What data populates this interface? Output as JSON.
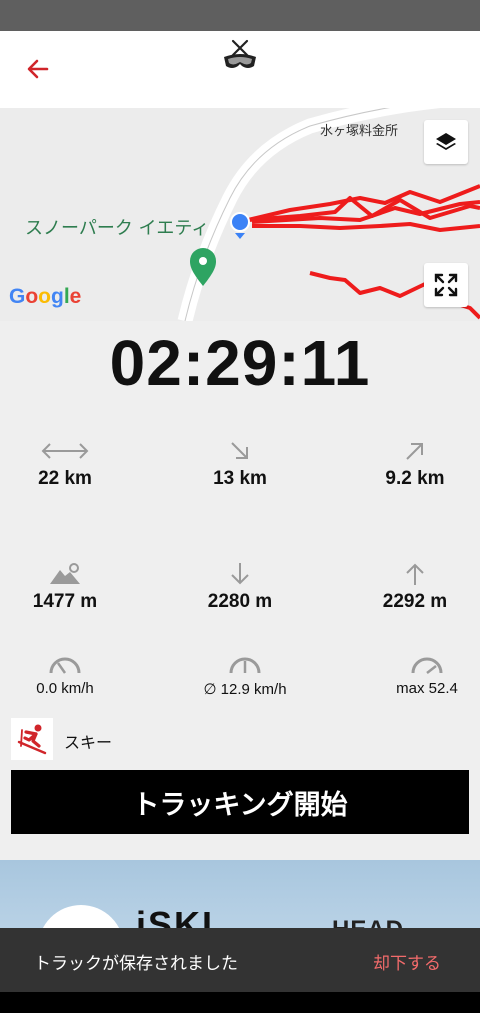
{
  "header": {
    "back_icon": "arrow-left-icon",
    "logo_icon": "ski-goggles-logo-icon",
    "accent": "#d0252a"
  },
  "map": {
    "street_label": "水ヶ塚料金所",
    "poi_label": "スノーパーク イエティ",
    "attribution": "Google",
    "layers_icon": "layers-icon",
    "fullscreen_icon": "fullscreen-icon",
    "track_color": "#ee1c1c"
  },
  "timer": "02:29:11",
  "stats": {
    "distance": "22 km",
    "downhill_distance": "13 km",
    "uphill_distance": "9.2 km",
    "altitude": "1477 m",
    "descent": "2280 m",
    "ascent": "2292 m",
    "speed": "0.0 km/h",
    "avg_speed": "∅ 12.9 km/h",
    "max_speed": "max 52.4"
  },
  "activity": {
    "label": "スキー",
    "icon": "skier-icon"
  },
  "start_button": "トラッキング開始",
  "banner": {
    "brand": "iSKI",
    "sponsor": "HEAD"
  },
  "snackbar": {
    "message": "トラックが保存されました",
    "action": "却下する"
  }
}
